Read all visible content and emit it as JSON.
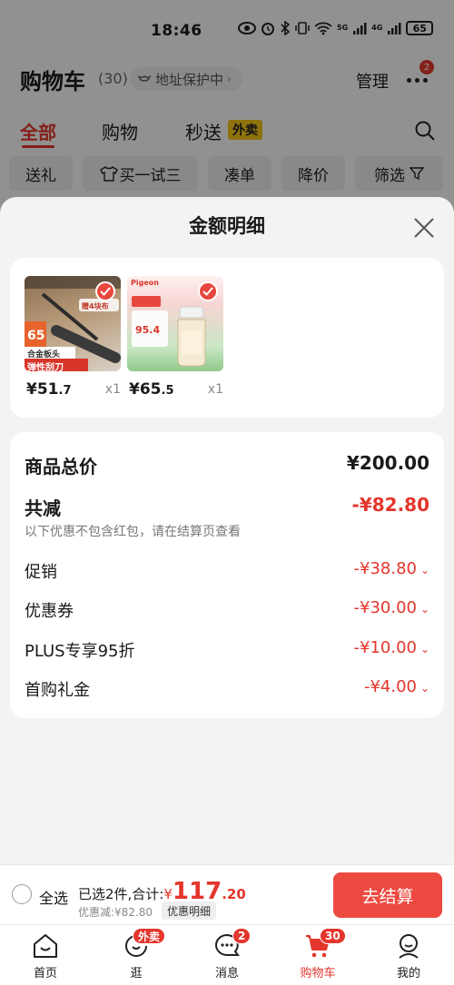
{
  "status": {
    "time": "18:46",
    "battery": "65",
    "net1": "5G",
    "net2": "4G"
  },
  "header": {
    "title": "购物车",
    "count": "(30)",
    "address_label": "地址保护中",
    "manage_label": "管理",
    "more_badge": "2"
  },
  "tabs": [
    {
      "label": "全部"
    },
    {
      "label": "购物"
    },
    {
      "label": "秒送"
    }
  ],
  "tab_badge": "外卖",
  "chips": [
    {
      "label": "送礼"
    },
    {
      "label": "买一试三"
    },
    {
      "label": "凑单"
    },
    {
      "label": "降价"
    },
    {
      "label": "筛选"
    }
  ],
  "sheet": {
    "title": "金额明细",
    "products": [
      {
        "price_int": "¥51",
        "price_dec": ".7",
        "qty": "x1",
        "img_tag": "65",
        "img_caption1": "合金板头",
        "img_caption2": "弹性刮刀",
        "img_badge": "赠4块布",
        "brand": ""
      },
      {
        "price_int": "¥65",
        "price_dec": ".5",
        "qty": "x1",
        "brand": "Pigeon",
        "img_price": "95.4"
      }
    ],
    "total_label": "商品总价",
    "total_value": "¥200.00",
    "reduce_label": "共减",
    "reduce_value": "-¥82.80",
    "note": "以下优惠不包含红包，请在结算页查看",
    "items": [
      {
        "label": "促销",
        "value": "-¥38.80"
      },
      {
        "label": "优惠券",
        "value": "-¥30.00"
      },
      {
        "label": "PLUS专享95折",
        "value": "-¥10.00"
      },
      {
        "label": "首购礼金",
        "value": "-¥4.00"
      }
    ]
  },
  "checkout": {
    "select_all": "全选",
    "summary_prefix": "已选2件,合计:",
    "yen": "¥",
    "total_int": "117",
    "total_dec": ".20",
    "discount_text": "优惠减:¥82.80",
    "detail_label": "优惠明细",
    "pay_label": "去结算"
  },
  "nav": [
    {
      "label": "首页"
    },
    {
      "label": "逛",
      "badge": "外卖"
    },
    {
      "label": "消息",
      "badge": "2"
    },
    {
      "label": "购物车",
      "badge": "30"
    },
    {
      "label": "我的"
    }
  ],
  "colors": {
    "accent": "#e3362c",
    "pay_button": "#ec4a40"
  }
}
